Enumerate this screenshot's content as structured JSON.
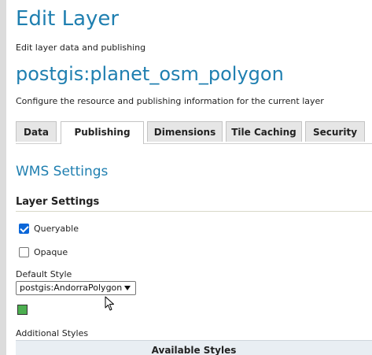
{
  "header": {
    "title": "Edit Layer",
    "subtitle": "Edit layer data and publishing",
    "layer_name": "postgis:planet_osm_polygon",
    "layer_description": "Configure the resource and publishing information for the current layer"
  },
  "tabs": [
    {
      "label": "Data",
      "active": false
    },
    {
      "label": "Publishing",
      "active": true
    },
    {
      "label": "Dimensions",
      "active": false
    },
    {
      "label": "Tile Caching",
      "active": false
    },
    {
      "label": "Security",
      "active": false
    }
  ],
  "wms": {
    "section_title": "WMS Settings",
    "layer_settings_title": "Layer Settings",
    "queryable": {
      "label": "Queryable",
      "checked": true
    },
    "opaque": {
      "label": "Opaque",
      "checked": false
    },
    "default_style": {
      "label": "Default Style",
      "selected": "postgis:AndorraPolygon",
      "swatch_color": "#4caf50"
    },
    "additional_styles": {
      "label": "Additional Styles",
      "available_header": "Available Styles"
    }
  },
  "colors": {
    "accent": "#1f7fb0",
    "checkbox_checked": "#0a66d8"
  }
}
